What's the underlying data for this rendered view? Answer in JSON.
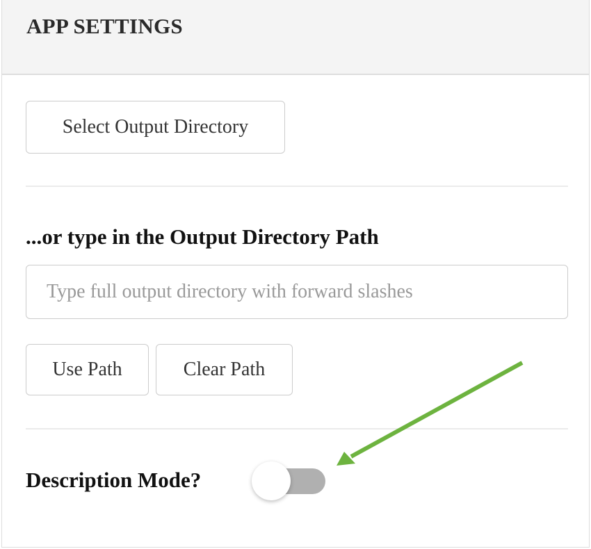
{
  "panel": {
    "title": "APP SETTINGS",
    "select_dir_button": "Select Output Directory",
    "path_heading": "...or type in the Output Directory Path",
    "path_input": {
      "value": "",
      "placeholder": "Type full output directory with forward slashes"
    },
    "use_path_button": "Use Path",
    "clear_path_button": "Clear Path",
    "description_mode": {
      "label": "Description Mode?",
      "enabled": false
    }
  },
  "annotation": {
    "arrow_color": "#6db33f",
    "track_color": "#b0b0b0"
  }
}
